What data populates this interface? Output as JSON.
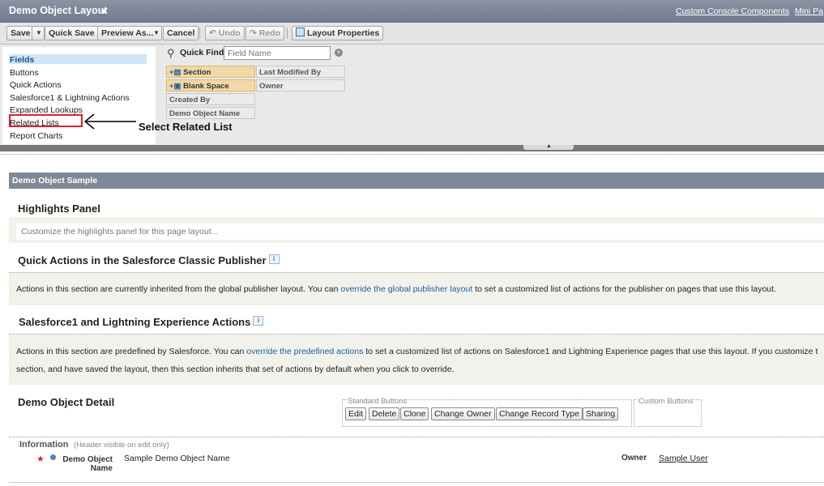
{
  "header": {
    "title": "Demo Object Layout",
    "links": [
      "Custom Console Components",
      "Mini Pa"
    ]
  },
  "toolbar": {
    "save": "Save",
    "quick_save": "Quick Save",
    "preview_as": "Preview As...",
    "cancel": "Cancel",
    "undo": "Undo",
    "redo": "Redo",
    "layout_properties": "Layout Properties"
  },
  "palette": {
    "categories": [
      "Fields",
      "Buttons",
      "Quick Actions",
      "Salesforce1 & Lightning Actions",
      "Expanded Lookups",
      "Related Lists",
      "Report Charts"
    ],
    "selected": "Fields",
    "quick_find_label": "Quick Find",
    "quick_find_placeholder": "Field Name",
    "items": [
      "Section",
      "Last Modified By",
      "Blank Space",
      "Owner",
      "Created By",
      "Demo Object Name"
    ]
  },
  "annotation": {
    "text": "Select Related List"
  },
  "layout": {
    "sample_title": "Demo Object Sample",
    "highlights": {
      "title": "Highlights Panel",
      "text": "Customize the highlights panel for this page layout..."
    },
    "quick_actions": {
      "title": "Quick Actions in the Salesforce Classic Publisher",
      "text_before": "Actions in this section are currently inherited from the global publisher layout. You can",
      "link": "override the global publisher layout",
      "text_after": "to set a customized list of actions for the publisher on pages that use this layout."
    },
    "s1_actions": {
      "title": "Salesforce1 and Lightning Experience Actions",
      "text_before": "Actions in this section are predefined by Salesforce. You can",
      "link": "override the predefined actions",
      "text_after": "to set a customized list of actions on Salesforce1 and Lightning Experience pages that use this layout. If you customize t",
      "line2": "section, and have saved the layout, then this section inherits that set of actions by default when you click to override."
    },
    "detail": {
      "title": "Demo Object Detail",
      "standard_buttons_label": "Standard Buttons",
      "custom_buttons_label": "Custom Buttons",
      "buttons": [
        "Edit",
        "Delete",
        "Clone",
        "Change Owner",
        "Change Record Type",
        "Sharing"
      ]
    },
    "information": {
      "title": "Information",
      "note": "(Header visible on edit only)",
      "field_label_line1": "Demo Object",
      "field_label_line2": "Name",
      "field_value": "Sample Demo Object Name",
      "owner_label": "Owner",
      "owner_value": "Sample User"
    }
  },
  "colors": {
    "header_bg": "#7f8896",
    "selected_category": "#cfe6f7",
    "highlight_chip": "#f1d8a6",
    "annotation_box": "#d9232d",
    "link": "#1f5c99"
  }
}
